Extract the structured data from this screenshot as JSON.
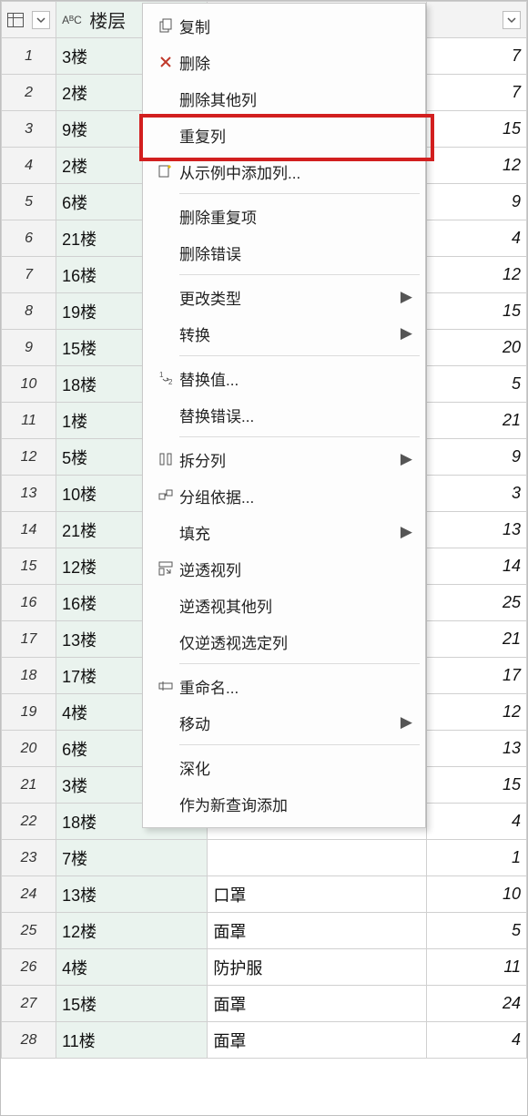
{
  "headers": {
    "col_a_type": "AᴮC",
    "col_a_name": "楼层",
    "col_b_name": "",
    "col_c_name": ""
  },
  "rows": [
    {
      "floor": "3楼",
      "item": "",
      "qty": 7
    },
    {
      "floor": "2楼",
      "item": "",
      "qty": 7
    },
    {
      "floor": "9楼",
      "item": "",
      "qty": 15
    },
    {
      "floor": "2楼",
      "item": "",
      "qty": 12
    },
    {
      "floor": "6楼",
      "item": "",
      "qty": 9
    },
    {
      "floor": "21楼",
      "item": "",
      "qty": 4
    },
    {
      "floor": "16楼",
      "item": "",
      "qty": 12
    },
    {
      "floor": "19楼",
      "item": "",
      "qty": 15
    },
    {
      "floor": "15楼",
      "item": "",
      "qty": 20
    },
    {
      "floor": "18楼",
      "item": "",
      "qty": 5
    },
    {
      "floor": "1楼",
      "item": "",
      "qty": 21
    },
    {
      "floor": "5楼",
      "item": "",
      "qty": 9
    },
    {
      "floor": "10楼",
      "item": "",
      "qty": 3
    },
    {
      "floor": "21楼",
      "item": "",
      "qty": 13
    },
    {
      "floor": "12楼",
      "item": "",
      "qty": 14
    },
    {
      "floor": "16楼",
      "item": "",
      "qty": 25
    },
    {
      "floor": "13楼",
      "item": "",
      "qty": 21
    },
    {
      "floor": "17楼",
      "item": "",
      "qty": 17
    },
    {
      "floor": "4楼",
      "item": "",
      "qty": 12
    },
    {
      "floor": "6楼",
      "item": "",
      "qty": 13
    },
    {
      "floor": "3楼",
      "item": "",
      "qty": 15
    },
    {
      "floor": "18楼",
      "item": "",
      "qty": 4
    },
    {
      "floor": "7楼",
      "item": "",
      "qty": 1
    },
    {
      "floor": "13楼",
      "item": "口罩",
      "qty": 10
    },
    {
      "floor": "12楼",
      "item": "面罩",
      "qty": 5
    },
    {
      "floor": "4楼",
      "item": "防护服",
      "qty": 11
    },
    {
      "floor": "15楼",
      "item": "面罩",
      "qty": 24
    },
    {
      "floor": "11楼",
      "item": "面罩",
      "qty": 4
    }
  ],
  "menu": {
    "copy": "复制",
    "delete": "删除",
    "delete_other": "删除其他列",
    "duplicate": "重复列",
    "from_examples": "从示例中添加列...",
    "remove_dup": "删除重复项",
    "remove_err": "删除错误",
    "change_type": "更改类型",
    "transform": "转换",
    "replace_val": "替换值...",
    "replace_err": "替换错误...",
    "split": "拆分列",
    "group_by": "分组依据...",
    "fill": "填充",
    "unpivot": "逆透视列",
    "unpivot_other": "逆透视其他列",
    "unpivot_sel": "仅逆透视选定列",
    "rename": "重命名...",
    "move": "移动",
    "drill": "深化",
    "as_new_query": "作为新查询添加"
  }
}
